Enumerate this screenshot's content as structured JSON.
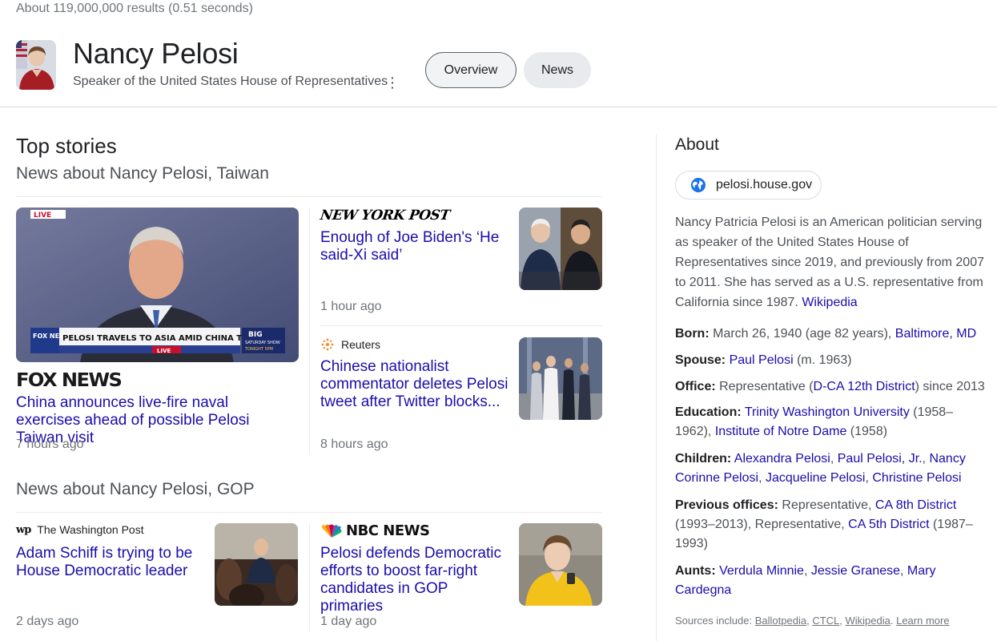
{
  "search": {
    "result_stats": "About 119,000,000 results (0.51 seconds)"
  },
  "entity": {
    "title": "Nancy Pelosi",
    "subtitle": "Speaker of the United States House of Representatives",
    "more_icon": "⋮",
    "tabs": [
      {
        "label": "Overview",
        "selected": true
      },
      {
        "label": "News",
        "selected": false
      }
    ]
  },
  "top_stories": {
    "title": "Top stories",
    "groups": [
      {
        "heading": "News about Nancy Pelosi, Taiwan",
        "stories": [
          {
            "source": "FOX NEWS",
            "title": "China announces live-fire naval exercises ahead of possible Pelosi Taiwan visit",
            "time": "7 hours ago",
            "thumb_texts": {
              "live": "LIVE",
              "chyron": "PELOSI TRAVELS TO ASIA AMID CHINA TENSIONS",
              "fox_news": "FOX NEWS",
              "live2": "LIVE",
              "big": "BIG",
              "saturday_show": "SATURDAY SHOW",
              "tonight": "TONIGHT 5PM"
            }
          },
          {
            "source": "NEW YORK POST",
            "title": "Enough of Joe Biden's ‘He said-Xi said’",
            "time": "1 hour ago"
          },
          {
            "source": "Reuters",
            "title": "Chinese nationalist commentator deletes Pelosi tweet after Twitter blocks...",
            "time": "8 hours ago"
          }
        ]
      },
      {
        "heading": "News about Nancy Pelosi, GOP",
        "stories": [
          {
            "source": "The Washington Post",
            "source_icon": "wp",
            "title": "Adam Schiff is trying to be House Democratic leader",
            "time": "2 days ago"
          },
          {
            "source": "NBC NEWS",
            "title": "Pelosi defends Democratic efforts to boost far-right candidates in GOP primaries",
            "time": "1 day ago"
          }
        ]
      }
    ]
  },
  "about": {
    "title": "About",
    "website": "pelosi.house.gov",
    "description": "Nancy Patricia Pelosi is an American politician serving as speaker of the United States House of Representatives since 2019, and previously from 2007 to 2011. She has served as a U.S. representative from California since 1987.",
    "wikipedia_link": "Wikipedia",
    "born": {
      "label": "Born:",
      "text": "March 26, 1940 (age 82 years),",
      "link": "Baltimore, MD"
    },
    "spouse": {
      "label": "Spouse:",
      "link": "Paul Pelosi",
      "text": "(m. 1963)"
    },
    "office": {
      "label": "Office:",
      "text1": "Representative (",
      "link": "D-CA 12th District",
      "text2": ") since 2013"
    },
    "education": {
      "label": "Education:",
      "link1": "Trinity Washington University",
      "text1": "(1958–1962),",
      "link2": "Institute of Notre Dame",
      "text2": "(1958)"
    },
    "children": {
      "label": "Children:",
      "links": [
        "Alexandra Pelosi",
        "Paul Pelosi, Jr.",
        "Nancy Corinne Pelosi",
        "Jacqueline Pelosi",
        "Christine Pelosi"
      ]
    },
    "previous_offices": {
      "label": "Previous offices:",
      "text1": "Representative,",
      "link1": "CA 8th District",
      "text2": "(1993–2013), Representative,",
      "link2": "CA 5th District",
      "text3": "(1987–1993)"
    },
    "aunts": {
      "label": "Aunts:",
      "links": [
        "Verdula Minnie",
        "Jessie Granese",
        "Mary Cardegna"
      ]
    },
    "sources": {
      "prefix": "Sources include:",
      "links": [
        "Ballotpedia",
        "CTCL",
        "Wikipedia"
      ],
      "learn_more": "Learn more"
    }
  },
  "colors": {
    "link": "#1a0dab",
    "muted": "#70757a",
    "text": "#4d5156",
    "globe": "#1a73e8"
  }
}
